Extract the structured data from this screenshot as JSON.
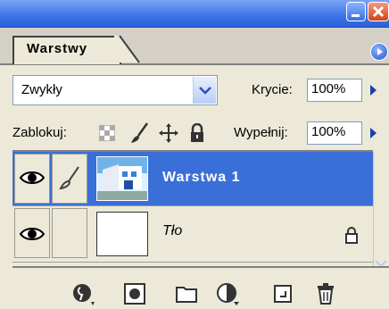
{
  "panel": {
    "tab_label": "Warstwy"
  },
  "blend_mode": {
    "value": "Zwykły"
  },
  "opacity": {
    "label": "Krycie:",
    "value": "100%"
  },
  "lock": {
    "label": "Zablokuj:",
    "icons": [
      "transparency-lock-icon",
      "brush-lock-icon",
      "move-lock-icon",
      "padlock-icon"
    ]
  },
  "fill": {
    "label": "Wypełnij:",
    "value": "100%"
  },
  "layers": [
    {
      "name": "Warstwa 1",
      "selected": true,
      "visible": true,
      "link_icon": "brush-icon"
    },
    {
      "name": "Tło",
      "selected": false,
      "visible": true,
      "locked": true
    }
  ],
  "colors": {
    "selection": "#3a6fd8",
    "panel_bg": "#ece9d8",
    "title_blue": "#3c74e8"
  },
  "toolbar_icons": [
    "layer-style-icon",
    "layer-mask-icon",
    "new-group-icon",
    "adjustment-layer-icon",
    "new-layer-icon",
    "trash-icon"
  ]
}
